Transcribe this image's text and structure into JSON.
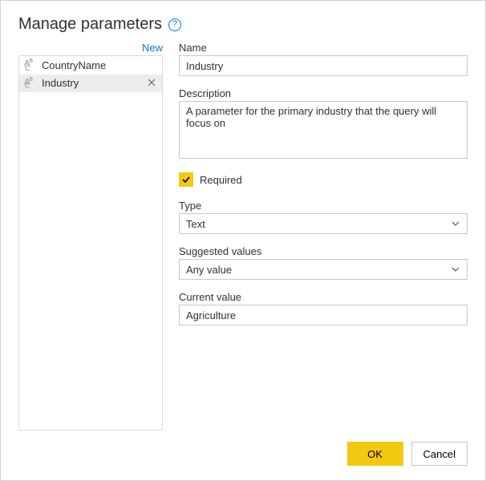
{
  "title": "Manage parameters",
  "new_label": "New",
  "parameters": {
    "items": [
      {
        "label": "CountryName",
        "selected": false
      },
      {
        "label": "Industry",
        "selected": true
      }
    ]
  },
  "form": {
    "name_label": "Name",
    "name_value": "Industry",
    "description_label": "Description",
    "description_value": "A parameter for the primary industry that the query will focus on",
    "required_label": "Required",
    "required_checked": true,
    "type_label": "Type",
    "type_value": "Text",
    "suggested_label": "Suggested values",
    "suggested_value": "Any value",
    "current_label": "Current value",
    "current_value": "Agriculture"
  },
  "buttons": {
    "ok": "OK",
    "cancel": "Cancel"
  },
  "colors": {
    "accent": "#f2c811",
    "link": "#0078d4"
  }
}
